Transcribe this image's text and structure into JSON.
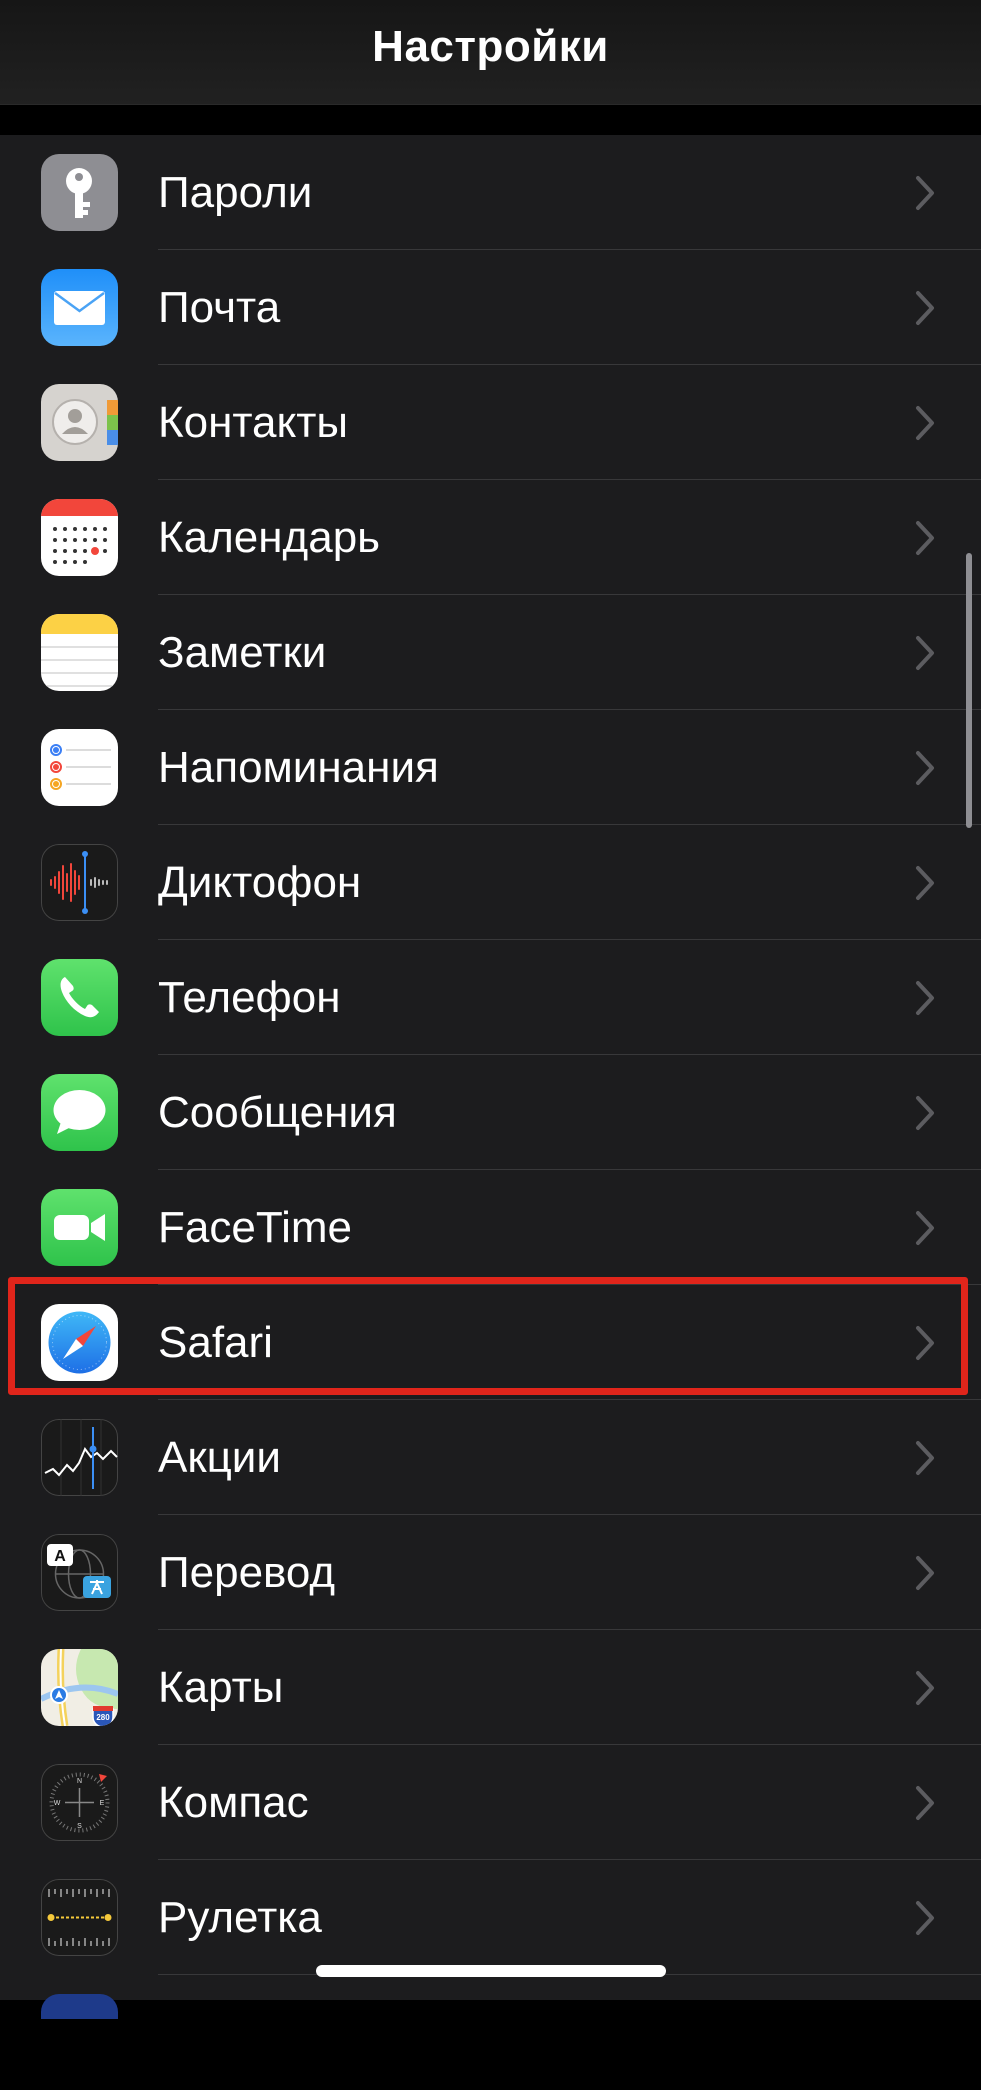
{
  "header": {
    "title": "Настройки"
  },
  "items": [
    {
      "label": "Пароли",
      "icon": "key-icon"
    },
    {
      "label": "Почта",
      "icon": "mail-icon"
    },
    {
      "label": "Контакты",
      "icon": "contacts-icon"
    },
    {
      "label": "Календарь",
      "icon": "calendar-icon"
    },
    {
      "label": "Заметки",
      "icon": "notes-icon"
    },
    {
      "label": "Напоминания",
      "icon": "reminders-icon"
    },
    {
      "label": "Диктофон",
      "icon": "voice-memos-icon"
    },
    {
      "label": "Телефон",
      "icon": "phone-icon"
    },
    {
      "label": "Сообщения",
      "icon": "messages-icon"
    },
    {
      "label": "FaceTime",
      "icon": "facetime-icon"
    },
    {
      "label": "Safari",
      "icon": "safari-icon",
      "highlighted": true
    },
    {
      "label": "Акции",
      "icon": "stocks-icon"
    },
    {
      "label": "Перевод",
      "icon": "translate-icon"
    },
    {
      "label": "Карты",
      "icon": "maps-icon"
    },
    {
      "label": "Компас",
      "icon": "compass-icon"
    },
    {
      "label": "Рулетка",
      "icon": "measure-icon"
    }
  ],
  "icon_text": {
    "translate_a": "A",
    "maps_route": "280"
  },
  "colors": {
    "background": "#1c1c1e",
    "separator": "#38383a",
    "highlight": "#e0251b",
    "chevron": "#5c5c60"
  }
}
